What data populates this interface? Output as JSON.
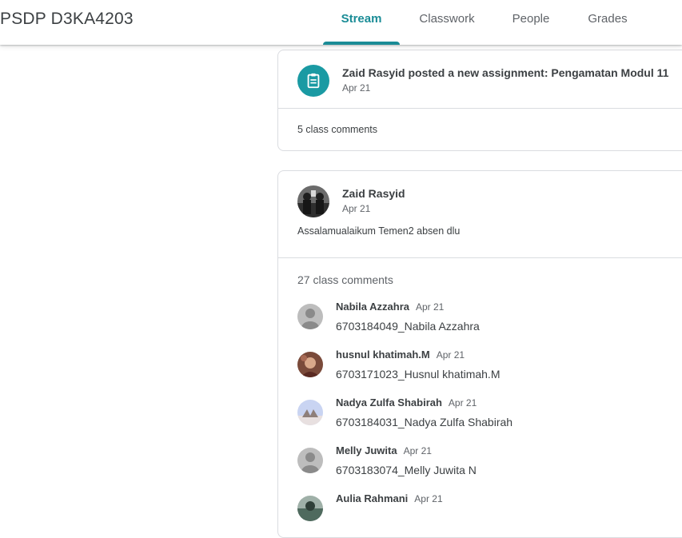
{
  "header": {
    "class_title": "PSDP D3KA4203",
    "tabs": [
      {
        "label": "Stream",
        "active": true
      },
      {
        "label": "Classwork",
        "active": false
      },
      {
        "label": "People",
        "active": false
      },
      {
        "label": "Grades",
        "active": false
      }
    ]
  },
  "colors": {
    "accent": "#1a8c96",
    "assignment_icon_bg": "#1a9aa3"
  },
  "assignment_post": {
    "icon": "assignment-icon",
    "title": "Zaid Rasyid posted a new assignment: Pengamatan Modul 11",
    "date": "Apr 21",
    "comments": "5 class comments"
  },
  "announcement": {
    "author": "Zaid Rasyid",
    "date": "Apr 21",
    "body": "Assalamualaikum Temen2 absen dlu",
    "comments_count": "27 class comments",
    "comments": [
      {
        "name": "Nabila Azzahra",
        "date": "Apr 21",
        "text": "6703184049_Nabila Azzahra",
        "avatar": "default-avatar"
      },
      {
        "name": "husnul khatimah.M",
        "date": "Apr 21",
        "text": "6703171023_Husnul khatimah.M",
        "avatar": "photo-avatar"
      },
      {
        "name": "Nadya Zulfa Shabirah",
        "date": "Apr 21",
        "text": "6703184031_Nadya Zulfa Shabirah",
        "avatar": "photo-avatar"
      },
      {
        "name": "Melly Juwita",
        "date": "Apr 21",
        "text": "6703183074_Melly Juwita N",
        "avatar": "default-avatar"
      },
      {
        "name": "Aulia Rahmani",
        "date": "Apr 21",
        "text": "",
        "avatar": "photo-avatar"
      }
    ]
  }
}
